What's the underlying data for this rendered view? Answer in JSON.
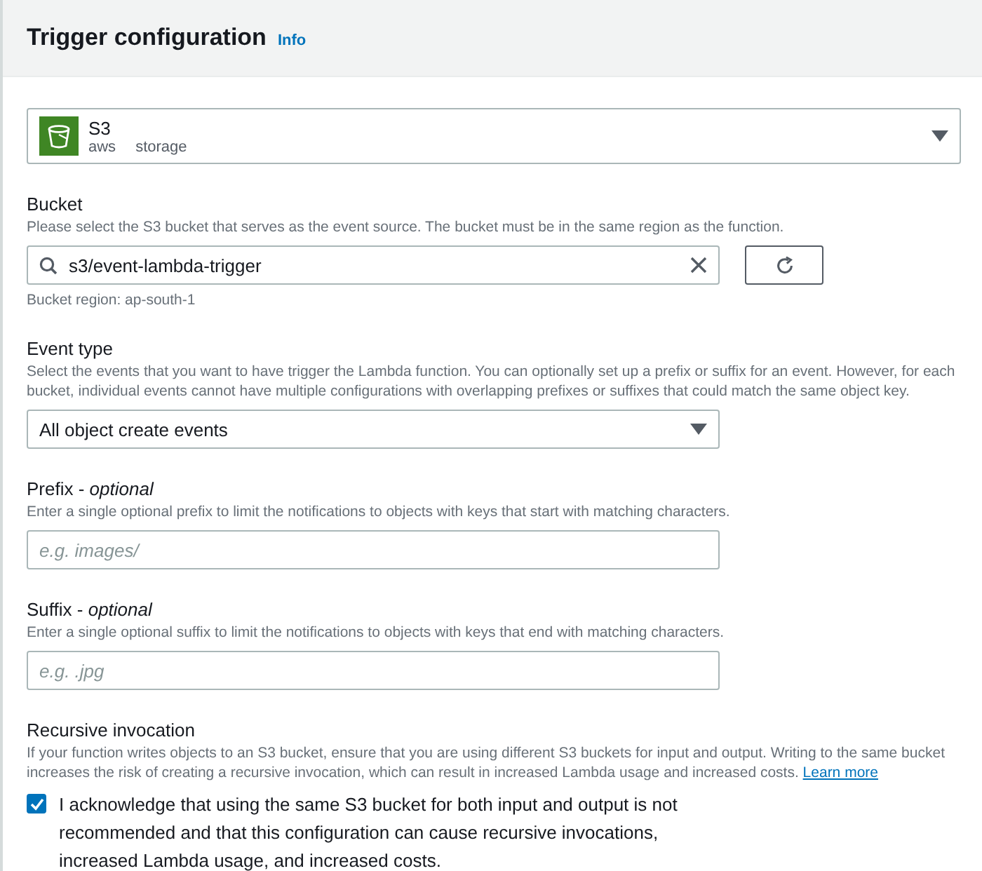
{
  "header": {
    "title": "Trigger configuration",
    "info_link": "Info"
  },
  "source_select": {
    "name": "S3",
    "tags": [
      "aws",
      "storage"
    ]
  },
  "bucket": {
    "label": "Bucket",
    "description": "Please select the S3 bucket that serves as the event source. The bucket must be in the same region as the function.",
    "value": "s3/event-lambda-trigger",
    "note": "Bucket region: ap-south-1"
  },
  "event_type": {
    "label": "Event type",
    "description": "Select the events that you want to have trigger the Lambda function. You can optionally set up a prefix or suffix for an event. However, for each bucket, individual events cannot have multiple configurations with overlapping prefixes or suffixes that could match the same object key.",
    "value": "All object create events"
  },
  "prefix": {
    "label": "Prefix - *optional*",
    "description": "Enter a single optional prefix to limit the notifications to objects with keys that start with matching characters.",
    "placeholder": "e.g. images/"
  },
  "suffix": {
    "label": "Suffix - *optional*",
    "description": "Enter a single optional suffix to limit the notifications to objects with keys that end with matching characters.",
    "placeholder": "e.g. .jpg"
  },
  "recursive": {
    "label": "Recursive invocation",
    "description": "If your function writes objects to an S3 bucket, ensure that you are using different S3 buckets for input and output. Writing to the same bucket increases the risk of creating a recursive invocation, which can result in increased Lambda usage and increased costs.",
    "link": "Learn more",
    "acknowledge": "I acknowledge that using the same S3 bucket for both input and output is not recommended and that this configuration can cause recursive invocations, increased Lambda usage, and increased costs.",
    "checked": true
  }
}
